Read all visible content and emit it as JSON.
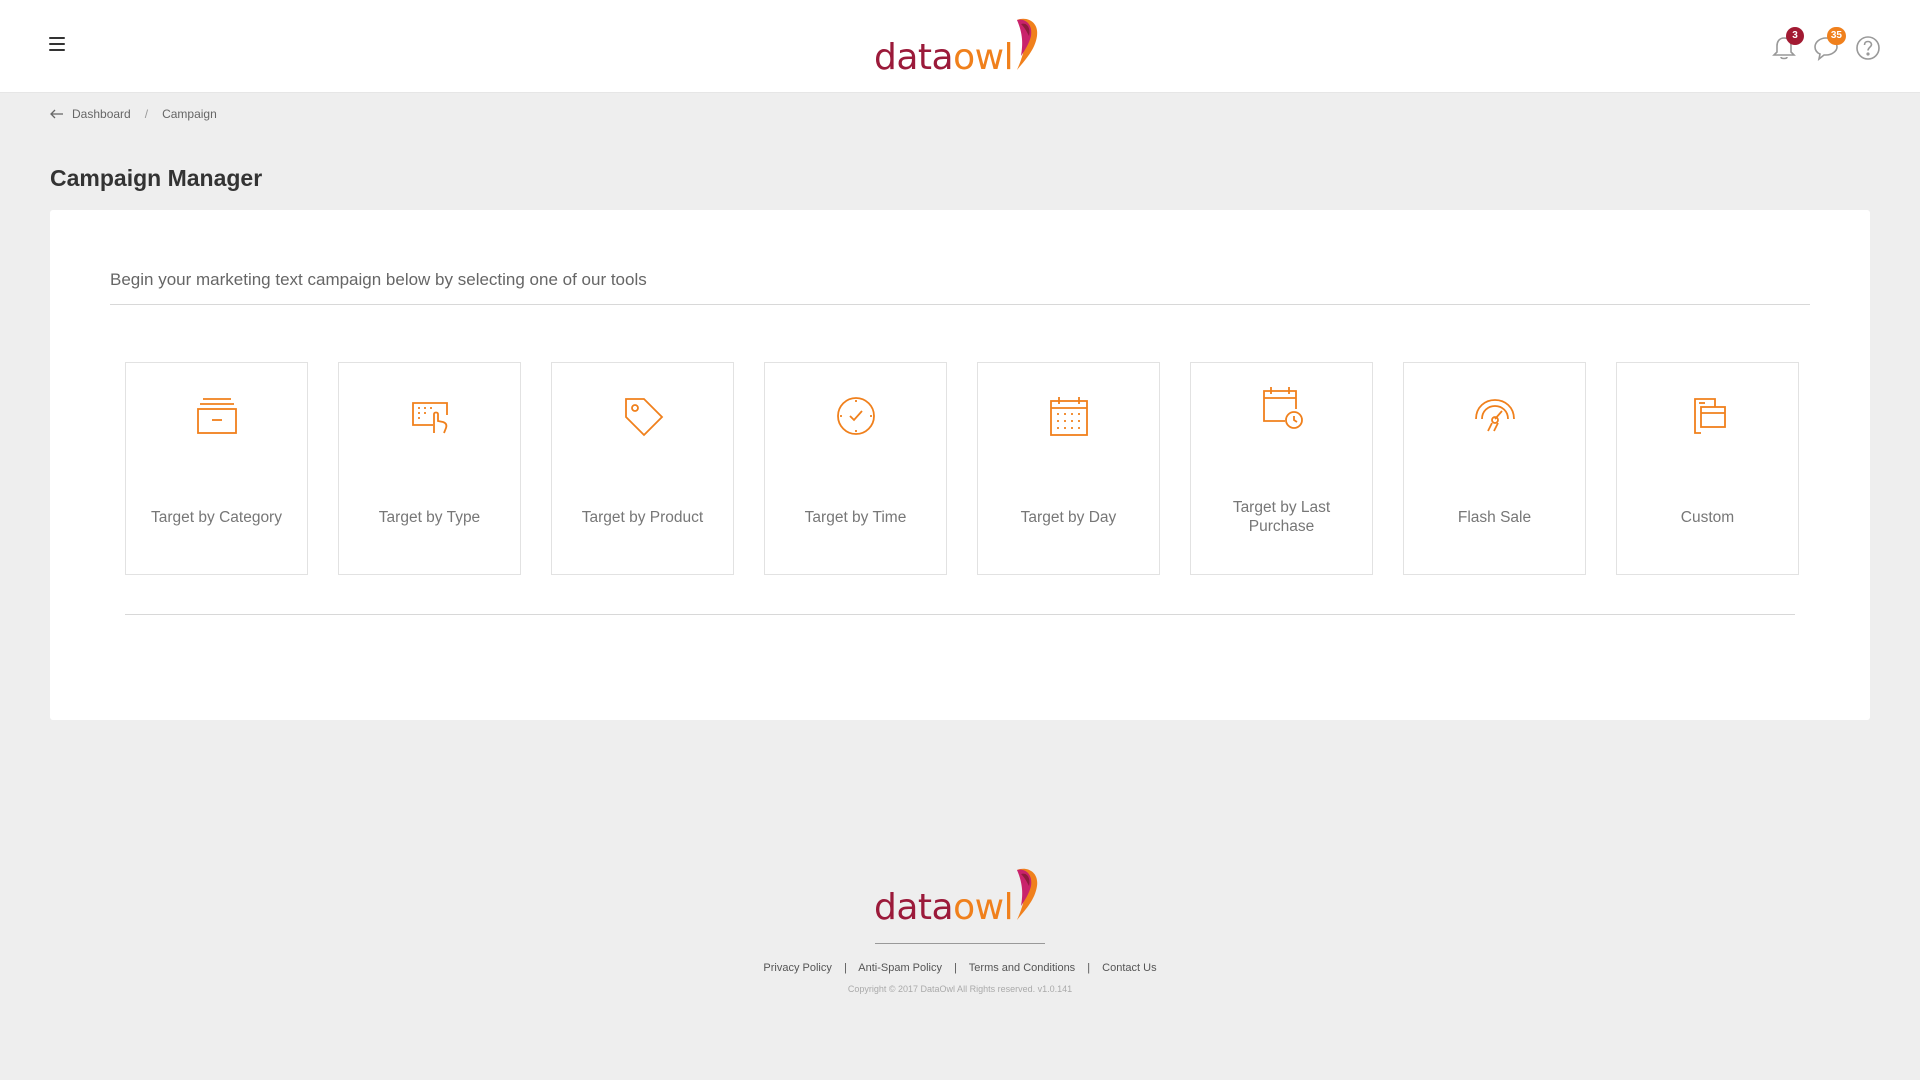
{
  "header": {
    "logo": {
      "text_data": "data",
      "text_owl": "owl"
    },
    "notifications": {
      "count": "3",
      "icon": "bell-icon"
    },
    "messages": {
      "count": "35",
      "icon": "chat-icon"
    },
    "help": {
      "icon": "help-icon"
    }
  },
  "breadcrumb": {
    "items": [
      {
        "label": "Dashboard"
      },
      {
        "label": "Campaign"
      }
    ],
    "separator": "/"
  },
  "page": {
    "title": "Campaign Manager",
    "intro": "Begin your marketing text campaign below by selecting one of our tools"
  },
  "tools": [
    {
      "label": "Target by Category",
      "icon": "archive-box-icon"
    },
    {
      "label": "Target by Type",
      "icon": "touch-keypad-icon"
    },
    {
      "label": "Target by Product",
      "icon": "tag-icon"
    },
    {
      "label": "Target by Time",
      "icon": "clock-icon"
    },
    {
      "label": "Target by Day",
      "icon": "calendar-icon"
    },
    {
      "label": "Target by Last Purchase",
      "icon": "calendar-clock-icon"
    },
    {
      "label": "Flash Sale",
      "icon": "speedometer-icon"
    },
    {
      "label": "Custom",
      "icon": "card-document-icon"
    }
  ],
  "footer": {
    "links": [
      {
        "label": "Privacy Policy"
      },
      {
        "label": "Anti-Spam Policy"
      },
      {
        "label": "Terms and Conditions"
      },
      {
        "label": "Contact Us"
      }
    ],
    "link_separator": "|",
    "copyright": "Copyright © 2017 DataOwl All Rights reserved. v1.0.141"
  },
  "colors": {
    "accent": "#f0801c",
    "brand_red": "#9b1a3a",
    "background": "#eeeeee"
  }
}
